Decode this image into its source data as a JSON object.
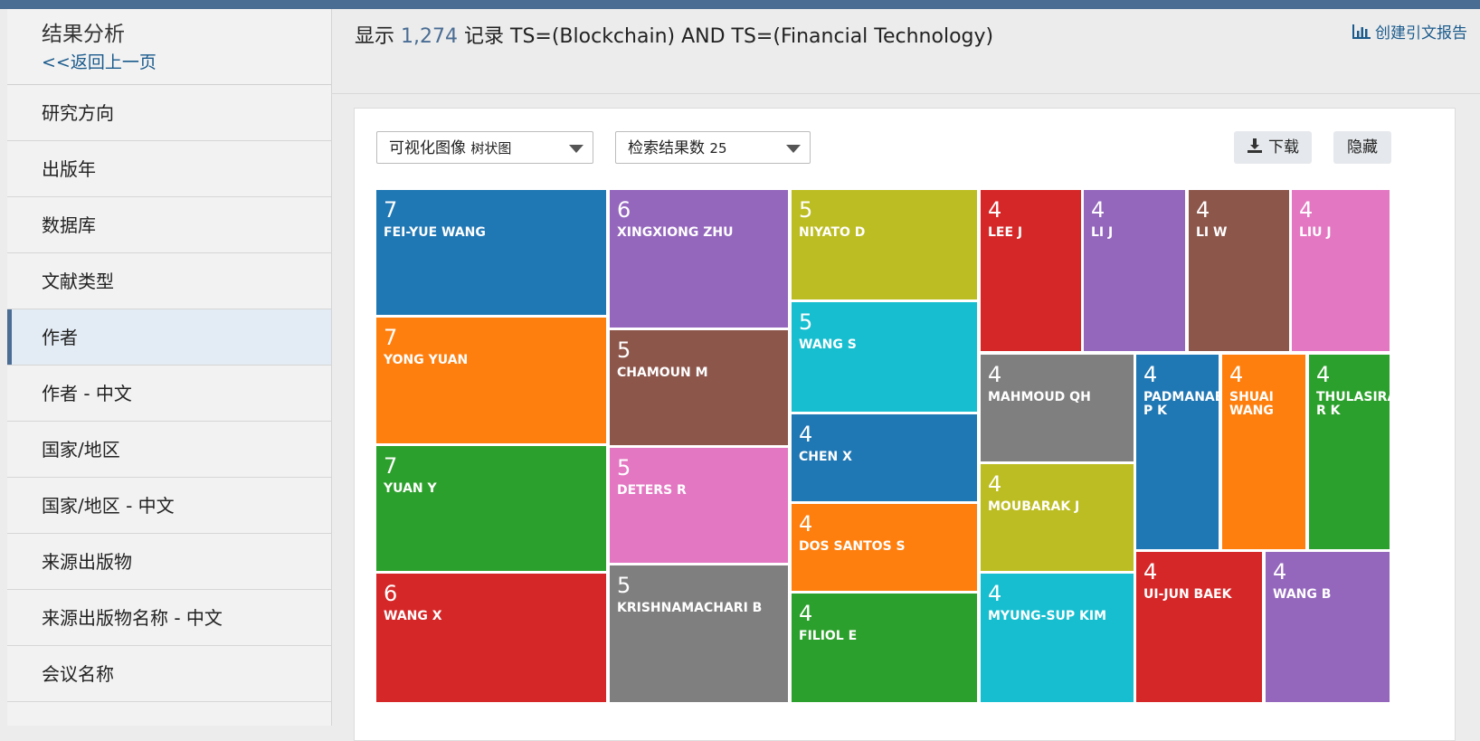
{
  "sidebar": {
    "title": "结果分析",
    "back": "<<返回上一页",
    "items": [
      {
        "label": "研究方向",
        "active": false
      },
      {
        "label": "出版年",
        "active": false
      },
      {
        "label": "数据库",
        "active": false
      },
      {
        "label": "文献类型",
        "active": false
      },
      {
        "label": "作者",
        "active": true
      },
      {
        "label": "作者 - 中文",
        "active": false
      },
      {
        "label": "国家/地区",
        "active": false
      },
      {
        "label": "国家/地区 - 中文",
        "active": false
      },
      {
        "label": "来源出版物",
        "active": false
      },
      {
        "label": "来源出版物名称 - 中文",
        "active": false
      },
      {
        "label": "会议名称",
        "active": false
      }
    ]
  },
  "header": {
    "prefix": "显示",
    "count": "1,274",
    "mid": "记录",
    "query": "TS=(Blockchain) AND TS=(Financial Technology)",
    "report_link": "创建引文报告",
    "report_icon": "bar-chart-icon"
  },
  "controls": {
    "viz_label": "可视化图像",
    "viz_value": "树状图",
    "count_label": "检索结果数",
    "count_value": "25",
    "download": "下载",
    "download_icon": "download-icon",
    "hide": "隐藏"
  },
  "chart_data": {
    "type": "treemap",
    "nodes": [
      {
        "name": "FEI-YUE WANG",
        "value": 7,
        "color": "#1f77b4"
      },
      {
        "name": "YONG YUAN",
        "value": 7,
        "color": "#ff7f0e"
      },
      {
        "name": "YUAN Y",
        "value": 7,
        "color": "#2ca02c"
      },
      {
        "name": "WANG X",
        "value": 6,
        "color": "#d62728"
      },
      {
        "name": "XINGXIONG ZHU",
        "value": 6,
        "color": "#9467bd"
      },
      {
        "name": "CHAMOUN M",
        "value": 5,
        "color": "#8c564b"
      },
      {
        "name": "DETERS R",
        "value": 5,
        "color": "#e377c2"
      },
      {
        "name": "KRISHNAMACHARI B",
        "value": 5,
        "color": "#7f7f7f"
      },
      {
        "name": "NIYATO D",
        "value": 5,
        "color": "#bcbd22"
      },
      {
        "name": "WANG S",
        "value": 5,
        "color": "#17becf"
      },
      {
        "name": "CHEN X",
        "value": 4,
        "color": "#1f77b4"
      },
      {
        "name": "DOS SANTOS S",
        "value": 4,
        "color": "#ff7f0e"
      },
      {
        "name": "FILIOL E",
        "value": 4,
        "color": "#2ca02c"
      },
      {
        "name": "LEE J",
        "value": 4,
        "color": "#d62728"
      },
      {
        "name": "LI J",
        "value": 4,
        "color": "#9467bd"
      },
      {
        "name": "LI W",
        "value": 4,
        "color": "#8c564b"
      },
      {
        "name": "LIU J",
        "value": 4,
        "color": "#e377c2"
      },
      {
        "name": "MAHMOUD QH",
        "value": 4,
        "color": "#7f7f7f"
      },
      {
        "name": "MOUBARAK J",
        "value": 4,
        "color": "#bcbd22"
      },
      {
        "name": "MYUNG-SUP KIM",
        "value": 4,
        "color": "#17becf"
      },
      {
        "name": "PADMANABHAN P K",
        "value": 4,
        "color": "#1f77b4"
      },
      {
        "name": "SHUAI WANG",
        "value": 4,
        "color": "#ff7f0e"
      },
      {
        "name": "THULASIRAMAN R K",
        "value": 4,
        "color": "#2ca02c"
      },
      {
        "name": "UI-JUN BAEK",
        "value": 4,
        "color": "#d62728"
      },
      {
        "name": "WANG B",
        "value": 4,
        "color": "#9467bd"
      }
    ]
  }
}
